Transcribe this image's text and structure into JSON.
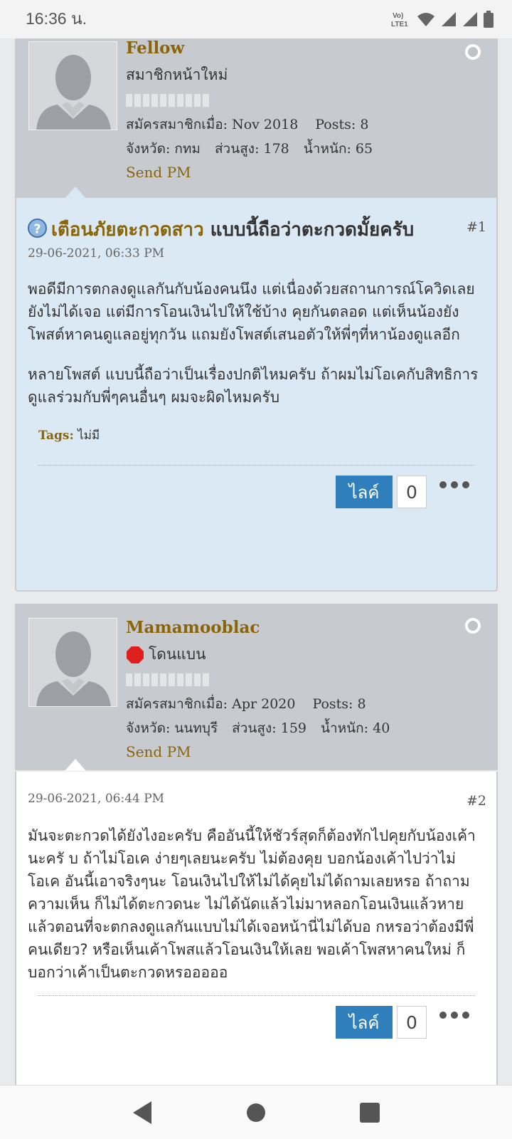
{
  "status_bar": {
    "time": "16:36 น.",
    "network_label": "Vo) LTE1"
  },
  "posts": [
    {
      "username": "Fellow",
      "user_title": "สมาชิกหน้าใหม่",
      "joined_label": "สมัครสมาชิกเมื่อ: Nov 2018",
      "posts_label": "Posts: 8",
      "province_label": "จังหวัด: กทม",
      "height_label": "ส่วนสูง: 178",
      "weight_label": "น้ำหนัก: 65",
      "send_pm": "Send PM",
      "number": "#1",
      "title_prefix": "เตือนภัยตะกวดสาว",
      "title": "แบบนี้ถือว่าตะกวดมั้ยครับ",
      "date": "29-06-2021, 06:33 PM",
      "paragraphs": [
        "พอดีมีการตกลงดูแลกันกับน้องคนนึง แต่เนื่องด้วยสถานการณ์โควิดเลยยังไม่ได้เจอ แต่มีการโอนเงินไปให้ใช้บ้าง คุยกันตลอด แต่เห็นน้องยังโพสต์หาคนดูแลอยู่ทุกวัน แถมยังโพสต์เสนอตัวให้พี่ๆที่หาน้องดูแลอีก",
        "หลายโพสต์ แบบนี้ถือว่าเป็นเรื่องปกติไหมครับ ถ้าผมไม่โอเคกับสิทธิการดูแลร่วมกับพี่ๆคนอื่นๆ ผมจะผิดไหมครับ"
      ],
      "tags_label": "Tags:",
      "tags_value": "ไม่มี",
      "like_label": "ไลค์",
      "like_count": "0"
    },
    {
      "username": "Mamamooblac",
      "user_title": "โดนแบน",
      "joined_label": "สมัครสมาชิกเมื่อ: Apr 2020",
      "posts_label": "Posts: 8",
      "province_label": "จังหวัด: นนทบุรี",
      "height_label": "ส่วนสูง: 159",
      "weight_label": "น้ำหนัก: 40",
      "send_pm": "Send PM",
      "number": "#2",
      "date": "29-06-2021, 06:44 PM",
      "paragraphs": [
        "มันจะตะกวดได้ยังไงอะครับ คืออันนี้ให้ชัวร์สุดก็ต้องทักไปคุยกับน้องเค้านะครั บ ถ้าไม่โอเค ง่ายๆเลยนะครับ ไม่ต้องคุย บอกน้องเค้าไปว่าไม่โอเค อันนี้เอาจริงๆนะ โอนเงินไปให้ไม่ได้คุยไม่ได้ถามเลยหรอ ถ้าถามความเห็น ก็ไม่ได้ตะกวดนะ ไม่ได้นัดแล้วไม่มาหลอกโอนเงินแล้วหาย แล้วตอนที่จะตกลงดูแลกันแบบไม่ได้เจอหน้านี่ไม่ได้บอ กหรอว่าต้องมีพี่คนเดียว? หรือเห็นเค้าโพสแล้วโอนเงินให้เลย พอเค้าโพสหาคนใหม่ ก็บอกว่าเค้าเป็นตะกวดหรอออออ"
      ],
      "like_label": "ไลค์",
      "like_count": "0"
    }
  ],
  "icons": {
    "online": "online-status-icon",
    "question": "question-icon",
    "ban": "stop-sign-icon",
    "more": "more-options-icon"
  },
  "colors": {
    "username": "#8a6508",
    "like_button": "#2f7fbd",
    "header_bg": "#c7cace",
    "first_post_bg": "#dbe9f5"
  }
}
